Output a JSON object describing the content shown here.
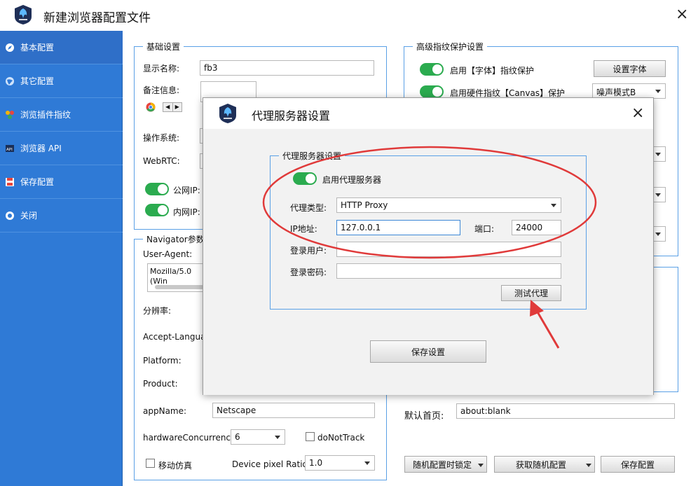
{
  "window": {
    "title": "新建浏览器配置文件",
    "close_icon": "×"
  },
  "sidebar": {
    "items": [
      {
        "label": "基本配置",
        "icon": "compass-icon"
      },
      {
        "label": "其它配置",
        "icon": "globe-icon"
      },
      {
        "label": "浏览插件指纹",
        "icon": "plugin-icon"
      },
      {
        "label": "浏览器 API",
        "icon": "api-icon"
      },
      {
        "label": "保存配置",
        "icon": "save-icon"
      },
      {
        "label": "关闭",
        "icon": "close-circle-icon"
      }
    ]
  },
  "basic": {
    "title": "基础设置",
    "display_name_label": "显示名称:",
    "display_name_value": "fb3",
    "remark_label": "备注信息:",
    "os_label": "操作系统:",
    "webrtc_label": "WebRTC:",
    "public_ip_label": "公网IP:",
    "lan_ip_label": "内网IP:"
  },
  "navigator": {
    "title": "Navigator参数",
    "ua_label": "User-Agent:",
    "ua_value": "Mozilla/5.0 (Win",
    "resolution_label": "分辨率:",
    "accept_lang_label": "Accept-Language",
    "platform_label": "Platform:",
    "product_label": "Product:",
    "appname_label": "appName:",
    "appname_value": "Netscape",
    "hw_label": "hardwareConcurrency:",
    "hw_value": "6",
    "dnt_label": "doNotTrack",
    "mobile_label": "移动仿真",
    "dpr_label": "Device pixel Ratio:",
    "dpr_value": "1.0"
  },
  "advanced": {
    "title": "高级指纹保护设置",
    "font_protect_label": "启用【字体】指纹保护",
    "font_button": "设置字体",
    "canvas_label": "启用硬件指纹【Canvas】保护",
    "canvas_mode": "噪声模式B",
    "homepage_label": "默认首页:",
    "homepage_value": "about:blank",
    "lock_random_button": "随机配置时锁定",
    "get_random_button": "获取随机配置",
    "save_button": "保存配置"
  },
  "modal": {
    "title": "代理服务器设置",
    "close_icon": "×",
    "group_title": "代理服务器设置",
    "enable_label": "启用代理服务器",
    "type_label": "代理类型:",
    "type_value": "HTTP Proxy",
    "ip_label": "IP地址:",
    "ip_value": "127.0.0.1",
    "port_label": "端口:",
    "port_value": "24000",
    "user_label": "登录用户:",
    "user_value": "",
    "pass_label": "登录密码:",
    "pass_value": "",
    "test_button": "测试代理",
    "save_button": "保存设置"
  },
  "colors": {
    "sidebar": "#2f7ad6",
    "toggle_on": "#2bab4f",
    "group_border": "#5aa0e6",
    "annotation": "#e03a3a"
  }
}
